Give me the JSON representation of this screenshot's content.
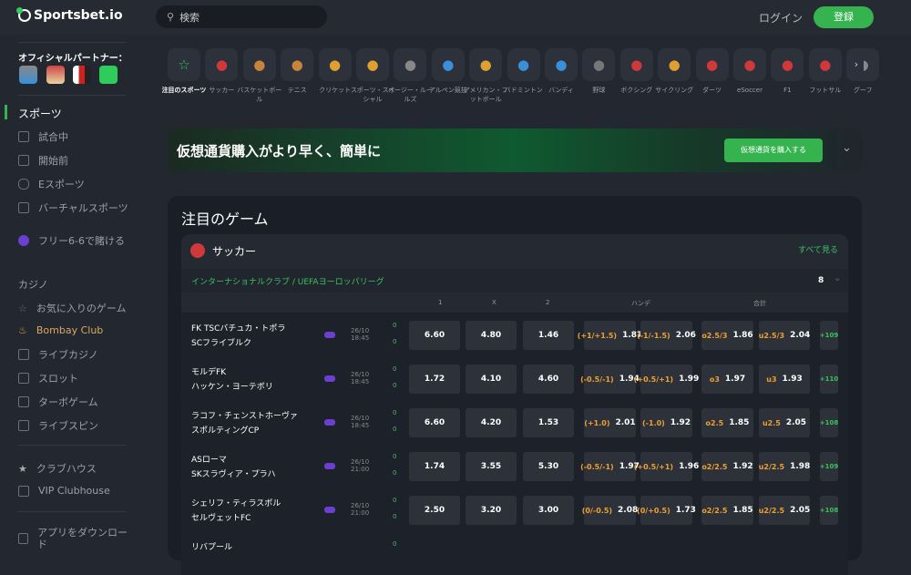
{
  "header": {
    "logo": "Sportsbet.io",
    "search_placeholder": "検索",
    "login": "ログイン",
    "register": "登録"
  },
  "sidebar": {
    "partners_title": "オフィシャルパートナー：",
    "sports_heading": "スポーツ",
    "sports_items": [
      "試合中",
      "開始前",
      "Eスポーツ",
      "バーチャルスポーツ"
    ],
    "promo": "フリー6-6で賭ける",
    "casino_heading": "カジノ",
    "casino_items": [
      "お気に入りのゲーム",
      "Bombay Club",
      "ライブカジノ",
      "スロット",
      "ターボゲーム",
      "ライブスピン"
    ],
    "club_items": [
      "クラブハウス",
      "VIP Clubhouse"
    ],
    "app": "アプリをダウンロード"
  },
  "sports": [
    {
      "label": "注目のスポーツ",
      "icon": "star-icon",
      "color": "#2ecc5a"
    },
    {
      "label": "サッカー",
      "icon": "soccer-icon",
      "color": "#d0393c"
    },
    {
      "label": "バスケットボール",
      "icon": "basketball-icon",
      "color": "#c8843a"
    },
    {
      "label": "テニス",
      "icon": "tennis-icon",
      "color": "#c8843a"
    },
    {
      "label": "クリケット",
      "icon": "cricket-icon",
      "color": "#e0a030"
    },
    {
      "label": "スポーツ・スペシャル",
      "icon": "rocket-icon",
      "color": "#e0a030"
    },
    {
      "label": "オージー・ルールズ",
      "icon": "aussie-ball-icon",
      "color": "#888"
    },
    {
      "label": "アルペン競技",
      "icon": "ski-icon",
      "color": "#3a8fd8"
    },
    {
      "label": "アメリカン・フットボール",
      "icon": "american-football-icon",
      "color": "#e0a030"
    },
    {
      "label": "バドミントン",
      "icon": "badminton-icon",
      "color": "#3a8fd8"
    },
    {
      "label": "バンディ",
      "icon": "bandy-icon",
      "color": "#3a8fd8"
    },
    {
      "label": "野球",
      "icon": "baseball-icon",
      "color": "#777"
    },
    {
      "label": "ボクシング",
      "icon": "boxing-icon",
      "color": "#d0393c"
    },
    {
      "label": "サイクリング",
      "icon": "cycling-icon",
      "color": "#e0a030"
    },
    {
      "label": "ダーツ",
      "icon": "darts-icon",
      "color": "#d0393c"
    },
    {
      "label": "eSoccer",
      "icon": "esoccer-icon",
      "color": "#d0393c"
    },
    {
      "label": "F1",
      "icon": "flag-icon",
      "color": "#d0393c"
    },
    {
      "label": "フットサル",
      "icon": "futsal-icon",
      "color": "#d0393c"
    },
    {
      "label": "グーフ",
      "icon": "more-sport-icon",
      "color": "#888"
    }
  ],
  "banner": {
    "text": "仮想通貨購入がより早く、簡単に",
    "button": "仮想通貨を購入する"
  },
  "featured": {
    "title": "注目のゲーム",
    "sport": "サッカー",
    "see_all": "すべて見る",
    "league_a": "インターナショナルクラブ",
    "league_b": "UEFAヨーロッパリーグ",
    "league_count": "8",
    "columns": {
      "c1": "1",
      "cx": "X",
      "c2": "2",
      "handicap": "ハンデ",
      "total": "合計"
    },
    "matches": [
      {
        "home": "FK TSCバチュカ・トポラ",
        "away": "SCフライブルク",
        "date": "26/10",
        "time": "18:45",
        "sh": "0",
        "sa": "0",
        "o1": "6.60",
        "ox": "4.80",
        "o2": "1.46",
        "h1l": "(+1/+1.5)",
        "h1": "1.87",
        "h2l": "(-1/-1.5)",
        "h2": "2.06",
        "t1l": "o2.5/3",
        "t1": "1.86",
        "t2l": "u2.5/3",
        "t2": "2.04",
        "more": "+109"
      },
      {
        "home": "モルデFK",
        "away": "ハッケン・ヨーテボリ",
        "date": "26/10",
        "time": "18:45",
        "sh": "0",
        "sa": "0",
        "o1": "1.72",
        "ox": "4.10",
        "o2": "4.60",
        "h1l": "(-0.5/-1)",
        "h1": "1.94",
        "h2l": "(+0.5/+1)",
        "h2": "1.99",
        "t1l": "o3",
        "t1": "1.97",
        "t2l": "u3",
        "t2": "1.93",
        "more": "+110"
      },
      {
        "home": "ラコフ・チェンストホーヴァ",
        "away": "スポルティングCP",
        "date": "26/10",
        "time": "18:45",
        "sh": "0",
        "sa": "0",
        "o1": "6.60",
        "ox": "4.20",
        "o2": "1.53",
        "h1l": "(+1.0)",
        "h1": "2.01",
        "h2l": "(-1.0)",
        "h2": "1.92",
        "t1l": "o2.5",
        "t1": "1.85",
        "t2l": "u2.5",
        "t2": "2.05",
        "more": "+108"
      },
      {
        "home": "ASローマ",
        "away": "SKスラヴィア・プラハ",
        "date": "26/10",
        "time": "21:00",
        "sh": "0",
        "sa": "0",
        "o1": "1.74",
        "ox": "3.55",
        "o2": "5.30",
        "h1l": "(-0.5/-1)",
        "h1": "1.97",
        "h2l": "(+0.5/+1)",
        "h2": "1.96",
        "t1l": "o2/2.5",
        "t1": "1.92",
        "t2l": "u2/2.5",
        "t2": "1.98",
        "more": "+109"
      },
      {
        "home": "シェリフ・ティラスポル",
        "away": "セルヴェットFC",
        "date": "26/10",
        "time": "21:00",
        "sh": "0",
        "sa": "0",
        "o1": "2.50",
        "ox": "3.20",
        "o2": "3.00",
        "h1l": "(0/-0.5)",
        "h1": "2.08",
        "h2l": "(0/+0.5)",
        "h2": "1.73",
        "t1l": "o2/2.5",
        "t1": "1.85",
        "t2l": "u2/2.5",
        "t2": "2.05",
        "more": "+108"
      },
      {
        "home": "リバプール",
        "away": "",
        "date": "",
        "time": "",
        "sh": "0",
        "sa": "",
        "o1": "",
        "ox": "",
        "o2": "",
        "h1l": "",
        "h1": "",
        "h2l": "",
        "h2": "",
        "t1l": "",
        "t1": "",
        "t2l": "",
        "t2": "",
        "more": ""
      }
    ]
  }
}
